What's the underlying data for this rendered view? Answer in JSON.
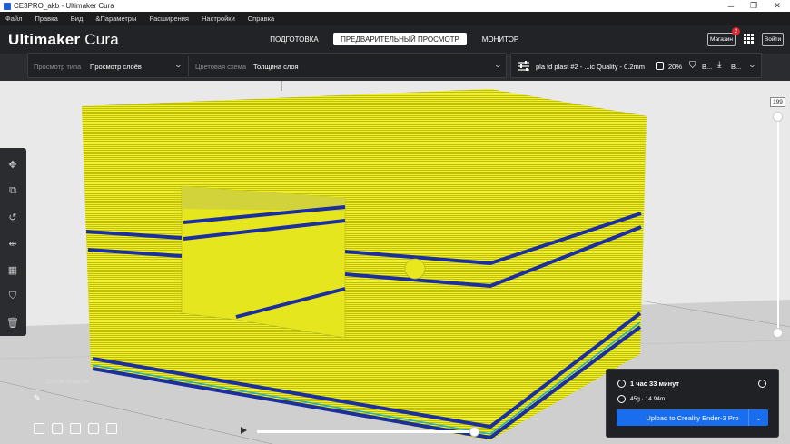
{
  "window": {
    "title": "CE3PRO_akb - Ultimaker Cura",
    "minimize": "─",
    "maximize": "❐",
    "close": "✕"
  },
  "menu": [
    "Файл",
    "Правка",
    "Вид",
    "&Параметры",
    "Расширения",
    "Настройки",
    "Справка"
  ],
  "header": {
    "logo_bold": "Ultimaker",
    "logo_light": "Cura",
    "stages": [
      "ПОДГОТОВКА",
      "ПРЕДВАРИТЕЛЬНЫЙ ПРОСМОТР",
      "МОНИТОР"
    ],
    "active_stage": "ПРЕДВАРИТЕЛЬНЫЙ ПРОСМОТР",
    "marketplace_label": "Магазин",
    "marketplace_badge": "2",
    "signin_label": "Войти"
  },
  "view_panel": {
    "view_type_label": "Просмотр типа",
    "view_type_value": "Просмотр слоёв",
    "color_scheme_label": "Цветовая схема",
    "color_scheme_value": "Толщина слоя"
  },
  "print_settings": {
    "profile": "pla fd plast #2 - ...ic Quality - 0.2mm",
    "infill": "20%",
    "support": "В...",
    "adhesion": "В..."
  },
  "layer_slider": {
    "value": "199",
    "fraction": 1.0
  },
  "object_list": {
    "label": "Список объектов"
  },
  "print_info": {
    "time": "1 час 33 минут",
    "material": "45g · 14.94m",
    "upload_button": "Upload to Creality Ender-3 Pro"
  },
  "icons": {
    "time": "clock-icon",
    "material": "spool-icon",
    "info": "info-icon"
  },
  "colors": {
    "model_yellow": "#f2f21a",
    "model_blue": "#1c2f9e",
    "accent_blue": "#196ef0",
    "panel_dark": "#202124"
  }
}
